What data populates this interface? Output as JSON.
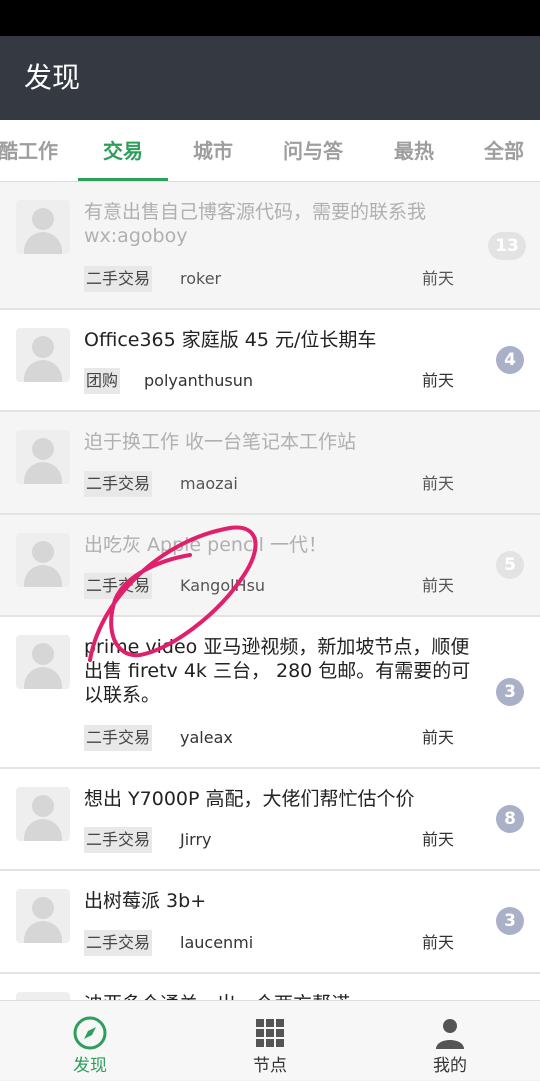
{
  "app_bar": {
    "title": "发现"
  },
  "tabs": [
    {
      "label": "酷工作"
    },
    {
      "label": "交易"
    },
    {
      "label": "城市"
    },
    {
      "label": "问与答"
    },
    {
      "label": "最热"
    },
    {
      "label": "全部"
    }
  ],
  "active_tab": "交易",
  "topics": [
    {
      "title": "有意出售自己博客源代码，需要的联系我 wx:agoboy",
      "node": "二手交易",
      "author": "roker",
      "time": "前天",
      "replies": "13",
      "read": true
    },
    {
      "title": "Office365 家庭版 45 元/位长期车",
      "node": "团购",
      "author": "polyanthusun",
      "time": "前天",
      "replies": "4",
      "read": false
    },
    {
      "title": "迫于换工作 收一台笔记本工作站",
      "node": "二手交易",
      "author": "maozai",
      "time": "前天",
      "replies": "",
      "read": true
    },
    {
      "title": "出吃灰 Apple pencil 一代！",
      "node": "二手交易",
      "author": "KangolHsu",
      "time": "前天",
      "replies": "5",
      "read": true
    },
    {
      "title": "prime video 亚马逊视频，新加坡节点，顺便出售 firetv 4k 三台， 280 包邮。有需要的可以联系。",
      "node": "二手交易",
      "author": "yaleax",
      "time": "前天",
      "replies": "3",
      "read": false
    },
    {
      "title": "想出 Y7000P 高配，大佬们帮忙估个价",
      "node": "二手交易",
      "author": "Jirry",
      "time": "前天",
      "replies": "8",
      "read": false
    },
    {
      "title": "出树莓派 3b+",
      "node": "二手交易",
      "author": "laucenmi",
      "time": "前天",
      "replies": "3",
      "read": false
    },
    {
      "title": "迪亚多个通关，出一个两方帮诺",
      "node": "",
      "author": "",
      "time": "",
      "replies": "",
      "read": false
    }
  ],
  "bottom_nav": [
    {
      "label": "发现",
      "icon": "compass-icon"
    },
    {
      "label": "节点",
      "icon": "grid-icon"
    },
    {
      "label": "我的",
      "icon": "person-icon"
    }
  ],
  "colors": {
    "accent": "#2e9e5b",
    "app_bar": "#353a42",
    "badge": "#aab0c7",
    "scribble": "#e0206a"
  }
}
